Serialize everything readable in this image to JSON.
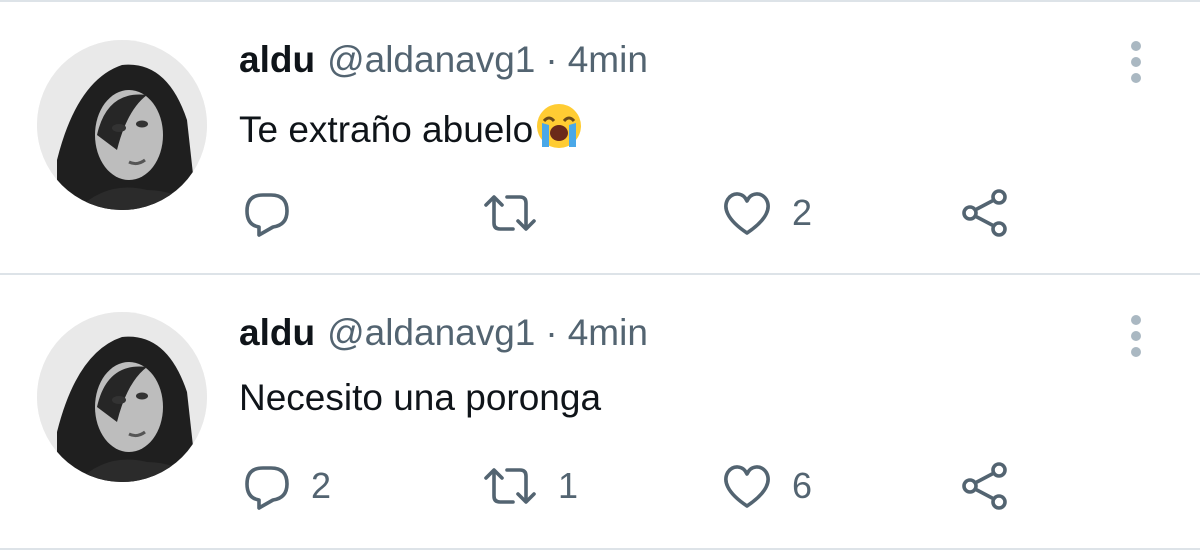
{
  "tweets": [
    {
      "display_name": "aldu",
      "handle": "@aldanavg1",
      "separator": "·",
      "time": "4min",
      "text": "Te extraño abuelo",
      "emoji": "loudly-crying-face",
      "replies": "",
      "retweets": "",
      "likes": "2"
    },
    {
      "display_name": "aldu",
      "handle": "@aldanavg1",
      "separator": "·",
      "time": "4min",
      "text": "Necesito una poronga",
      "emoji": "",
      "replies": "2",
      "retweets": "1",
      "likes": "6"
    }
  ],
  "colors": {
    "text_primary": "#0f1419",
    "text_secondary": "#536471",
    "divider": "#dde3e8",
    "more_dots": "#aab8c2"
  }
}
